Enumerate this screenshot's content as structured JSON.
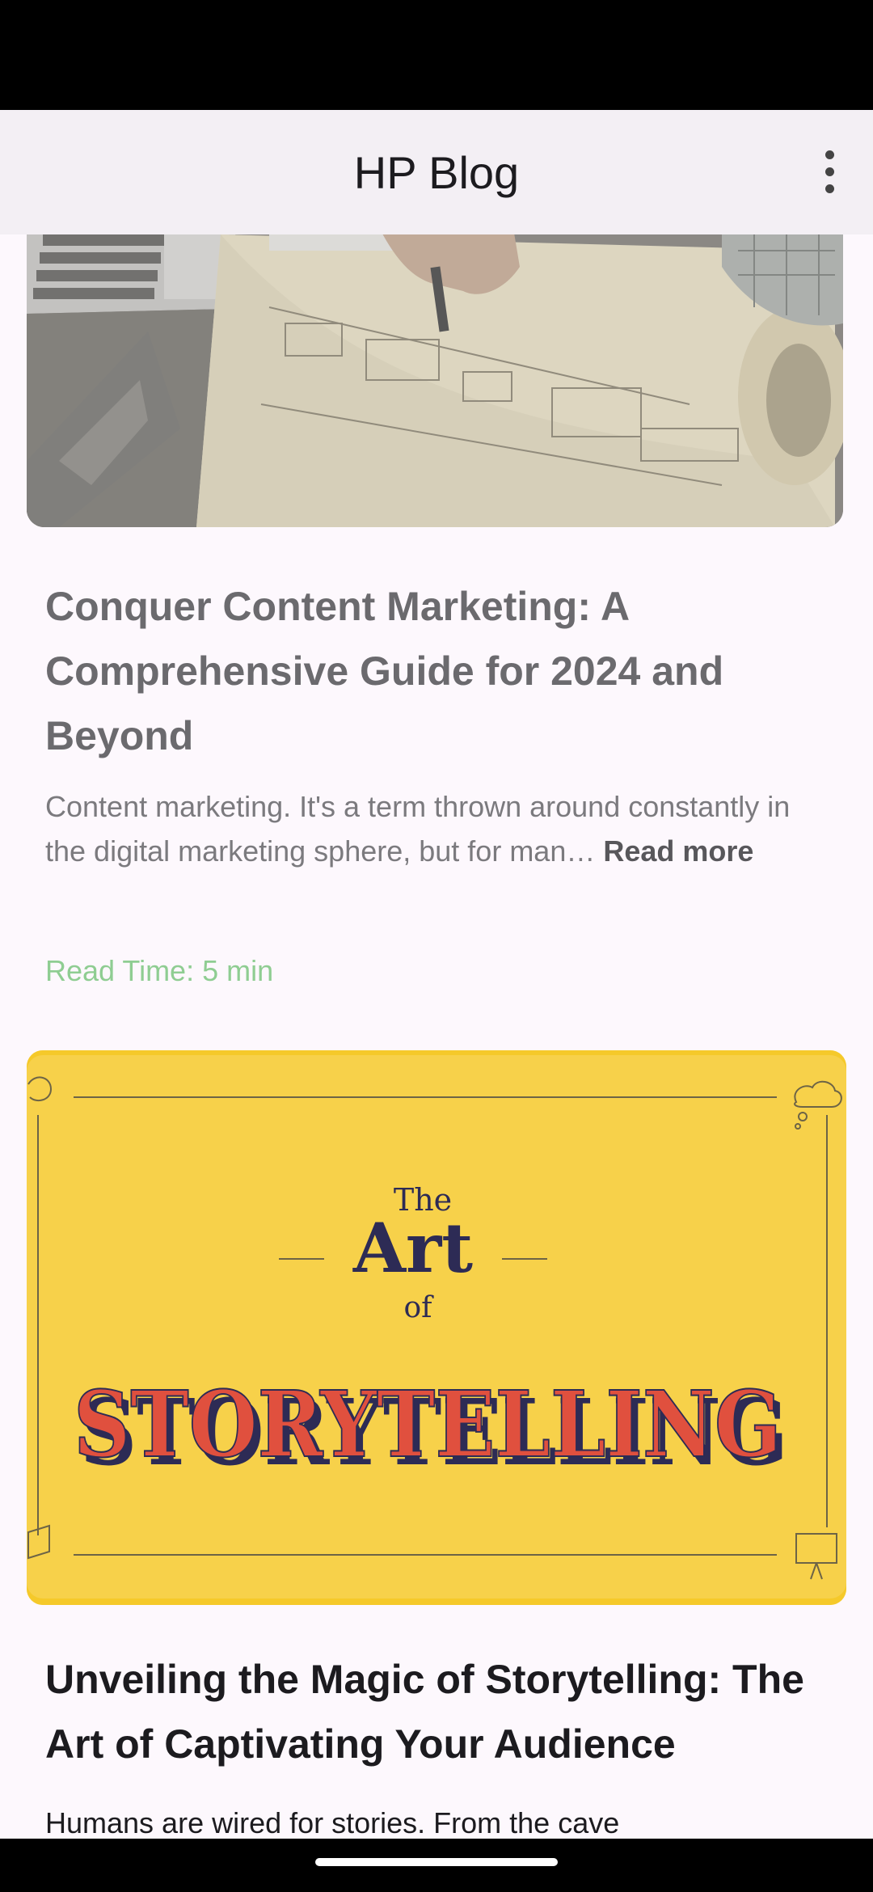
{
  "app_bar": {
    "title": "HP Blog",
    "menu_icon": "more-vertical-icon"
  },
  "posts": [
    {
      "image": "blueprint-drawing-photo",
      "title": "Conquer Content Marketing: A Comprehensive Guide for 2024 and Beyond",
      "excerpt": "Content marketing. It's a term thrown around constantly in the digital marketing sphere, but for man…",
      "read_more": "Read more",
      "read_time": "Read Time: 5 min"
    },
    {
      "image": "art-of-storytelling-banner",
      "image_text": {
        "line1": "The",
        "line2": "Art",
        "line3": "of",
        "line4": "STORYTELLING"
      },
      "title": "Unveiling the Magic of Storytelling: The Art of Captivating Your Audience",
      "excerpt": "Humans are wired for stories.   From the cave"
    }
  ],
  "colors": {
    "read_time": "#8fcd92",
    "banner_bg": "#f7d14a",
    "banner_red": "#e0503e",
    "banner_navy": "#2d2b55"
  }
}
